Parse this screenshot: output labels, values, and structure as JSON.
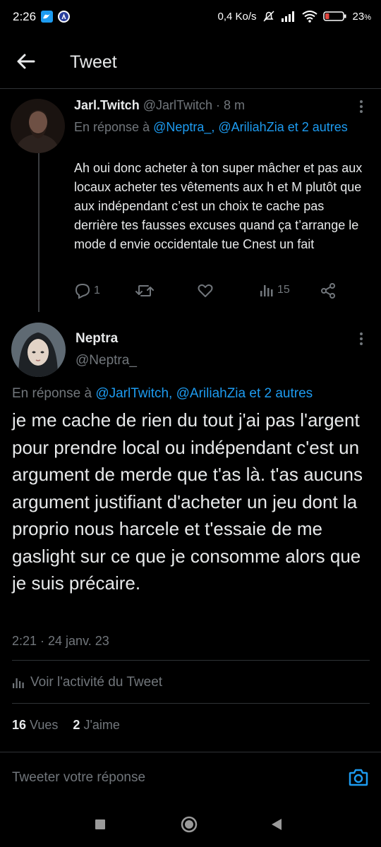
{
  "status_bar": {
    "time": "2:26",
    "network_speed": "0,4 Ko/s",
    "battery": "23",
    "battery_unit": "%",
    "battery_level_percent": 23
  },
  "header": {
    "title": "Tweet"
  },
  "reply_tweet": {
    "name": "Jarl.Twitch",
    "handle": "@JarlTwitch",
    "separator": "·",
    "time_ago": "8 m",
    "reply_prefix": "En réponse à",
    "reply_to": "@Neptra_, @AriliahZia et 2 autres",
    "text": "Ah oui donc acheter à ton super mâcher et pas aux locaux acheter tes vêtements aux h et M plutôt que aux indépendant c’est un choix te cache pas derrière tes fausses excuses quand ça t’arrange le mode d envie occidentale tue Cnest un fait",
    "reply_count": "1",
    "views_count": "15"
  },
  "main_tweet": {
    "name": "Neptra",
    "handle": "@Neptra_",
    "reply_prefix": "En réponse à",
    "reply_to": "@JarlTwitch, @AriliahZia et 2 autres",
    "text": "je me cache de rien du tout j'ai pas l'argent pour prendre local ou indépendant c'est un argument de merde que t'as là. t'as aucuns argument justifiant d'acheter un jeu dont la proprio nous harcele et t'essaie de me gaslight sur ce que je consomme alors que je suis précaire.",
    "timestamp": "2:21 · 24 janv. 23",
    "activity_label": "Voir l'activité du Tweet",
    "views_num": "16",
    "views_label": "Vues",
    "likes_num": "2",
    "likes_label": "J'aime"
  },
  "composer": {
    "placeholder": "Tweeter votre réponse"
  },
  "colors": {
    "accent": "#1d9bf0",
    "background": "#000000",
    "muted": "#71767b",
    "divider": "#2f3336"
  }
}
